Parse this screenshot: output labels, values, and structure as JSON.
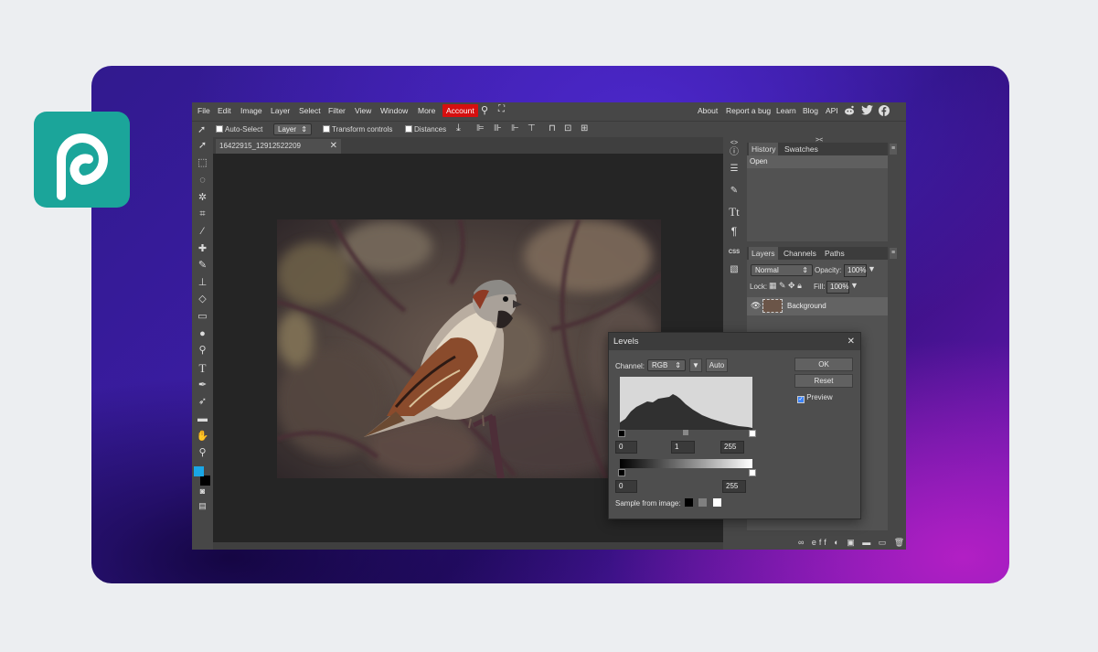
{
  "menu": {
    "items": [
      "File",
      "Edit",
      "Image",
      "Layer",
      "Select",
      "Filter",
      "View",
      "Window",
      "More"
    ],
    "account": "Account",
    "right_items": [
      "About",
      "Report a bug",
      "Learn",
      "Blog",
      "API"
    ]
  },
  "options": {
    "auto_select": "Auto-Select",
    "layer_select": "Layer",
    "transform_controls": "Transform controls",
    "distances": "Distances"
  },
  "document": {
    "tab_name": "16422915_12912522209"
  },
  "history": {
    "tab_active": "History",
    "tab_other": "Swatches",
    "entries": [
      "Open"
    ]
  },
  "layers": {
    "tabs": [
      "Layers",
      "Channels",
      "Paths"
    ],
    "blend_mode": "Normal",
    "opacity_label": "Opacity:",
    "opacity_value": "100%",
    "lock_label": "Lock:",
    "fill_label": "Fill:",
    "fill_value": "100%",
    "layer_name": "Background"
  },
  "levels": {
    "title": "Levels",
    "channel_label": "Channel:",
    "channel_value": "RGB",
    "auto": "Auto",
    "ok": "OK",
    "reset": "Reset",
    "preview": "Preview",
    "input_black": "0",
    "input_gamma": "1",
    "input_white": "255",
    "output_black": "0",
    "output_white": "255",
    "sample_label": "Sample from image:"
  },
  "colors": {
    "accent_account": "#d50f0f",
    "foreground_swatch": "#1aa7e6",
    "background_swatch": "#000000",
    "brand": "#1ba59a"
  },
  "icons": [
    "move-icon",
    "marquee-icon",
    "lasso-icon",
    "magic-wand-icon",
    "crop-icon",
    "eyedropper-icon",
    "healing-icon",
    "brush-icon",
    "stamp-icon",
    "eraser-icon",
    "gradient-icon",
    "blur-icon",
    "dodge-icon",
    "type-icon",
    "pen-icon",
    "path-select-icon",
    "shape-icon",
    "hand-icon",
    "zoom-icon"
  ]
}
